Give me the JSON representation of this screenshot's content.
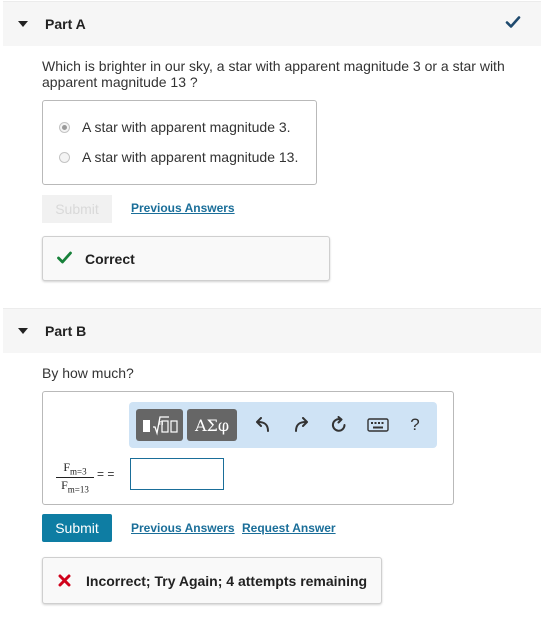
{
  "colors": {
    "accent": "#0e7da3",
    "link": "#1a6e99",
    "correct": "#17813a",
    "incorrect": "#d0021b"
  },
  "part_a": {
    "title": "Part A",
    "status_icon": "checkmark-icon",
    "question": "Which is brighter in our sky, a star with apparent magnitude 3 or a star with apparent magnitude 13 ?",
    "choices": [
      {
        "label": "A star with apparent magnitude 3.",
        "selected": true
      },
      {
        "label": "A star with apparent magnitude 13.",
        "selected": false
      }
    ],
    "submit_label": "Submit",
    "previous_answers_label": "Previous Answers",
    "feedback": "Correct"
  },
  "part_b": {
    "title": "Part B",
    "question": "By how much?",
    "toolbar": {
      "greek_label": "ΑΣφ",
      "help_label": "?",
      "icons": [
        "templates-icon",
        "undo-icon",
        "redo-icon",
        "reset-icon",
        "keyboard-icon",
        "help-icon"
      ]
    },
    "fraction": {
      "num_base": "F",
      "num_sub": "m=3",
      "den_base": "F",
      "den_sub": "m=13"
    },
    "equals": "= =",
    "answer_value": "",
    "submit_label": "Submit",
    "previous_answers_label": "Previous Answers",
    "request_answer_label": "Request Answer",
    "feedback": "Incorrect; Try Again; 4 attempts remaining"
  }
}
